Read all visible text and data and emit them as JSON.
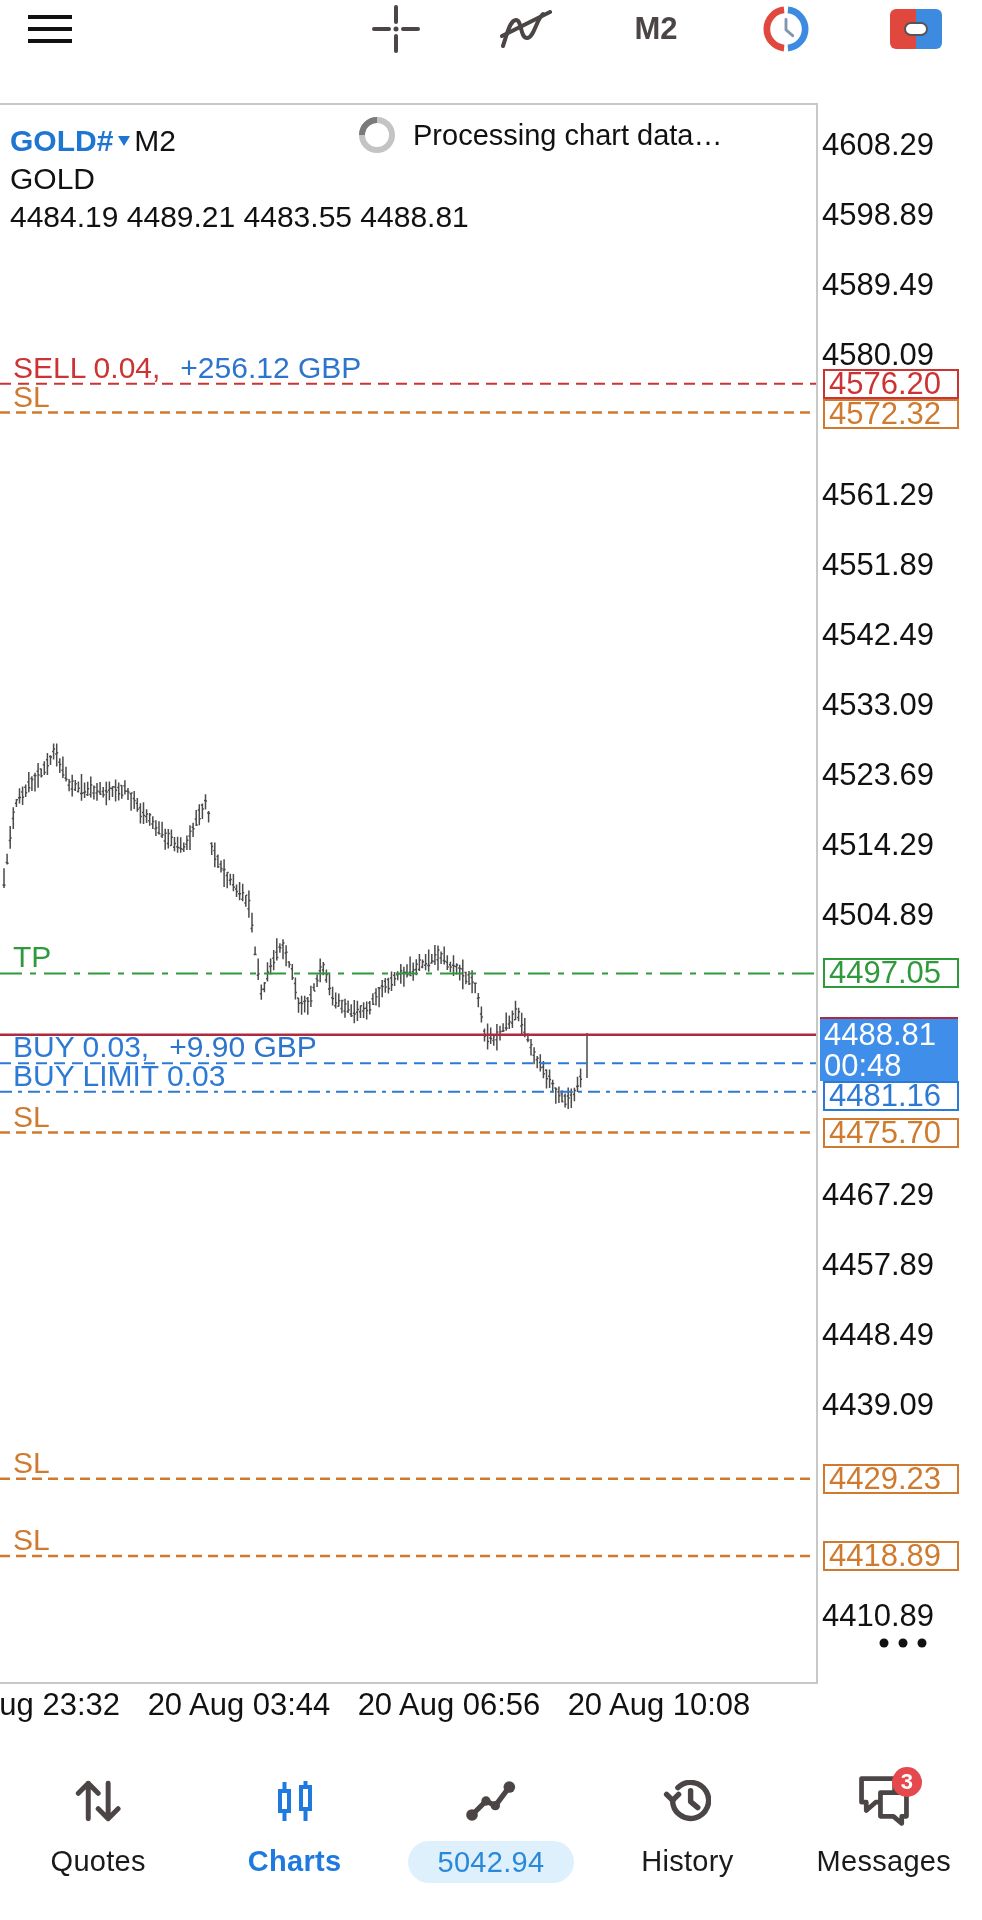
{
  "toolbar": {
    "timeframe": "M2"
  },
  "chart": {
    "symbol": "GOLD#",
    "timeframe": "M2",
    "description": "GOLD",
    "ohlc": "4484.19 4489.21 4483.55 4488.81",
    "status": "Processing chart data…",
    "price_axis": [
      "4608.29",
      "4598.89",
      "4589.49",
      "4580.09",
      "4561.29",
      "4551.89",
      "4542.49",
      "4533.09",
      "4523.69",
      "4514.29",
      "4504.89",
      "4467.29",
      "4457.89",
      "4448.49",
      "4439.09",
      "4410.89"
    ],
    "time_axis": [
      "ug 23:32",
      "20 Aug 03:44",
      "20 Aug 06:56",
      "20 Aug 10:08"
    ],
    "bid": {
      "price": "4488.81",
      "time": "00:48"
    },
    "lines": [
      {
        "kind": "order",
        "label": "SELL 0.04,",
        "profit": "+256.12 GBP",
        "price": "4576.20",
        "color": "#cc3333"
      },
      {
        "kind": "sl",
        "label": "SL",
        "price": "4572.32",
        "color": "#cf7a2e"
      },
      {
        "kind": "tp",
        "label": "TP",
        "price": "4497.05",
        "color": "#2f9a3c"
      },
      {
        "kind": "order",
        "label": "BUY 0.03,",
        "profit": "+9.90 GBP",
        "color": "#2d7ad6"
      },
      {
        "kind": "limit",
        "label": "BUY LIMIT 0.03",
        "price": "4481.16",
        "color": "#2d7ad6"
      },
      {
        "kind": "sl",
        "label": "SL",
        "price": "4475.70",
        "color": "#cf7a2e"
      },
      {
        "kind": "sl",
        "label": "SL",
        "price": "4429.23",
        "color": "#cf7a2e"
      },
      {
        "kind": "sl",
        "label": "SL",
        "price": "4418.89",
        "color": "#cf7a2e"
      }
    ]
  },
  "nav": [
    {
      "kind": "tab",
      "label": "Quotes",
      "selected": false
    },
    {
      "kind": "tab",
      "label": "Charts",
      "selected": true
    },
    {
      "kind": "balance",
      "label": "5042.94",
      "selected": false
    },
    {
      "kind": "tab",
      "label": "History",
      "selected": false
    },
    {
      "kind": "tab",
      "label": "Messages",
      "selected": false,
      "badge": "3"
    }
  ]
}
